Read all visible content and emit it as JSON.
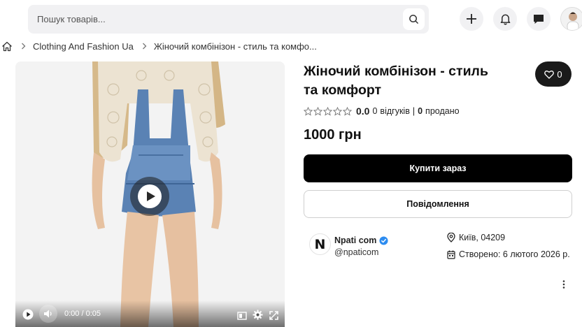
{
  "header": {
    "search_placeholder": "Пошук товарів..."
  },
  "breadcrumb": {
    "items": [
      "Clothing And Fashion Ua",
      "Жіночий комбінізон - стиль та комфо..."
    ]
  },
  "media": {
    "time": "0:00 / 0:05"
  },
  "product": {
    "title_line1": "Жіночий комбінізон - стиль",
    "title_line2": "та комфорт",
    "favorites_count": "0",
    "rating": "0.0",
    "reviews_count": "0",
    "reviews_label": "відгуків",
    "separator": "|",
    "sold_count": "0",
    "sold_label": "продано",
    "price": "1000 грн",
    "buy_label": "Купити зараз",
    "message_label": "Повідомлення"
  },
  "seller": {
    "logo_letter": "N",
    "name": "Npati com",
    "handle": "@npaticom",
    "location": "Київ, 04209",
    "created": "Створено: 6 лютого 2026 р."
  },
  "colors": {
    "primary_button": "#000000",
    "verified": "#2d8cf0",
    "search_bg": "#f1f1f3"
  },
  "icons": [
    "search-icon",
    "plus-icon",
    "bell-icon",
    "chat-icon",
    "home-icon",
    "chevron-right-icon",
    "heart-icon",
    "star-icon",
    "play-icon",
    "volume-icon",
    "subtitles-icon",
    "settings-icon",
    "fullscreen-icon",
    "verified-icon",
    "location-pin-icon",
    "calendar-icon",
    "more-vertical-icon"
  ]
}
